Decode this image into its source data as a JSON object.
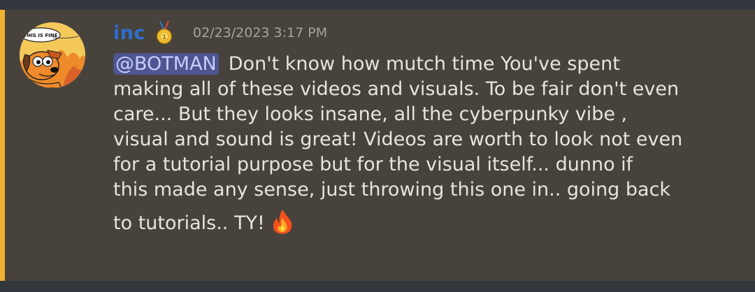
{
  "message": {
    "author": "inc",
    "author_color": "#2f6fcf",
    "author_badge_icon": "medal-icon",
    "timestamp": "02/23/2023 3:17 PM",
    "mention": "@BOTMAN",
    "mention_color": "#4e5591",
    "highlight_bar_color": "#f0b232",
    "lines": [
      "Don't know how mutch time You've spent",
      "making all of these videos and visuals. To be fair don't even",
      "care... But they looks insane, all the cyberpunky vibe ,",
      "visual and sound is great! Videos are worth to look not even",
      "for a tutorial purpose but for the visual itself...  dunno if",
      "this made any sense, just throwing this one in.. going back",
      "to tutorials.. TY!"
    ],
    "trailing_emoji": "fire-icon",
    "avatar": {
      "icon": "this-is-fine-dog-avatar",
      "speech_text": "THIS IS FINE"
    }
  }
}
